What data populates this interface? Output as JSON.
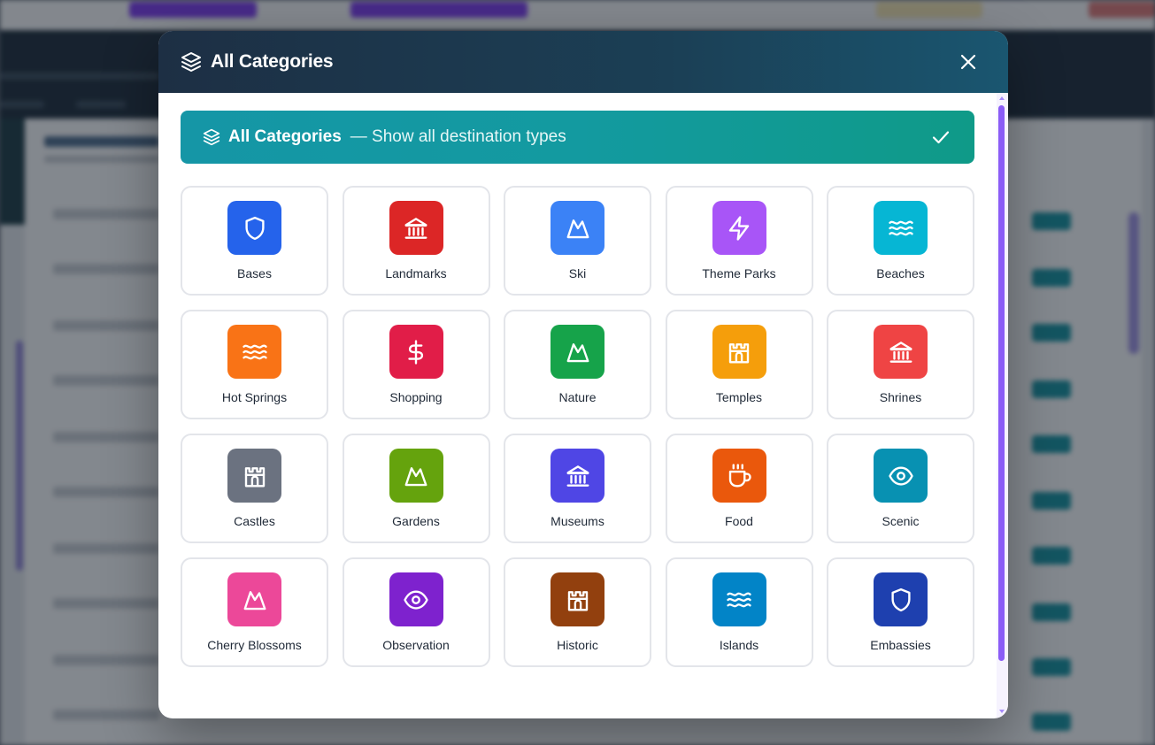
{
  "modal": {
    "title": "All Categories",
    "title_icon": "layers-icon",
    "close_icon": "close-icon",
    "header_color": "#1d2f44"
  },
  "all_option": {
    "title": "All Categories",
    "description": "— Show all destination types",
    "icon": "layers-icon",
    "selected": true,
    "check_icon": "check-icon",
    "color": "#1596a6"
  },
  "categories": [
    {
      "label": "Bases",
      "icon": "shield-icon",
      "color": "#2563eb"
    },
    {
      "label": "Landmarks",
      "icon": "landmark-icon",
      "color": "#dc2626"
    },
    {
      "label": "Ski",
      "icon": "mountain-icon",
      "color": "#3b82f6"
    },
    {
      "label": "Theme Parks",
      "icon": "lightning-icon",
      "color": "#a855f7"
    },
    {
      "label": "Beaches",
      "icon": "waves-icon",
      "color": "#06b6d4"
    },
    {
      "label": "Hot Springs",
      "icon": "waves-icon",
      "color": "#f97316"
    },
    {
      "label": "Shopping",
      "icon": "dollar-icon",
      "color": "#e11d48"
    },
    {
      "label": "Nature",
      "icon": "mountain-icon",
      "color": "#16a34a"
    },
    {
      "label": "Temples",
      "icon": "castle-icon",
      "color": "#f59e0b"
    },
    {
      "label": "Shrines",
      "icon": "landmark-icon",
      "color": "#ef4444"
    },
    {
      "label": "Castles",
      "icon": "castle-icon",
      "color": "#6b7280"
    },
    {
      "label": "Gardens",
      "icon": "mountain-icon",
      "color": "#65a30d"
    },
    {
      "label": "Museums",
      "icon": "landmark-icon",
      "color": "#4f46e5"
    },
    {
      "label": "Food",
      "icon": "coffee-icon",
      "color": "#ea580c"
    },
    {
      "label": "Scenic",
      "icon": "eye-icon",
      "color": "#0891b2"
    },
    {
      "label": "Cherry Blossoms",
      "icon": "mountain-icon",
      "color": "#ec4899"
    },
    {
      "label": "Observation",
      "icon": "eye-icon",
      "color": "#7e22ce"
    },
    {
      "label": "Historic",
      "icon": "castle-icon",
      "color": "#92400e"
    },
    {
      "label": "Islands",
      "icon": "waves-icon",
      "color": "#0284c7"
    },
    {
      "label": "Embassies",
      "icon": "shield-icon",
      "color": "#1e40af"
    }
  ]
}
